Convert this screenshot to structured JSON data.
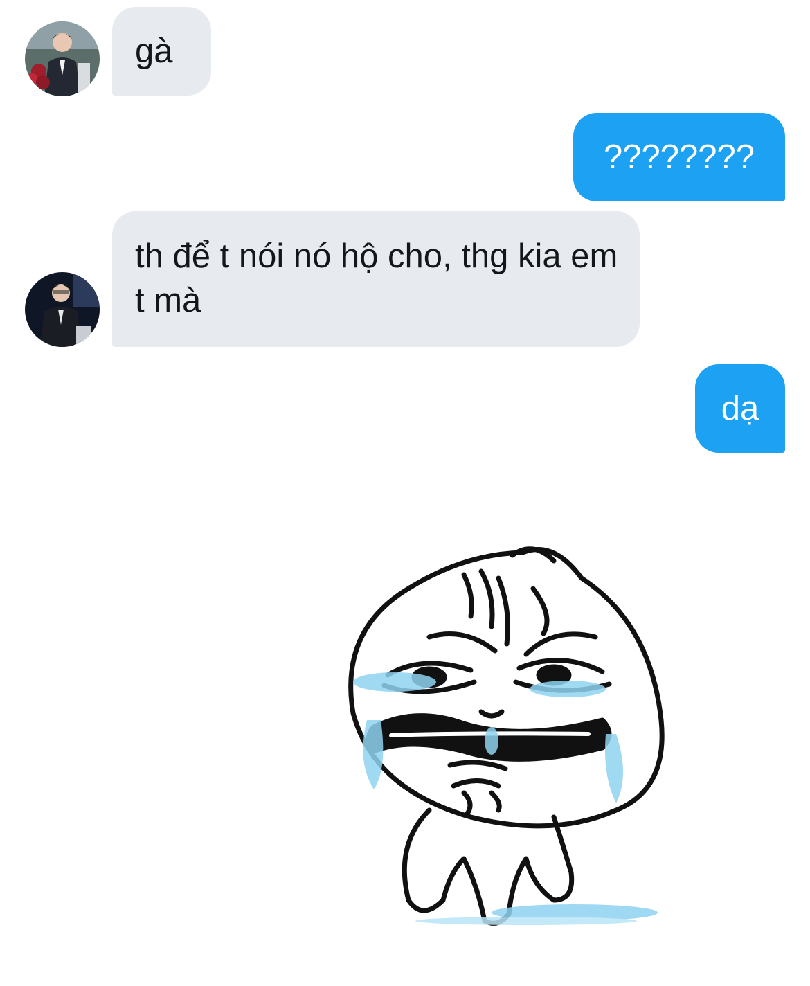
{
  "messages": [
    {
      "side": "received",
      "text": "gà",
      "avatar": "avatar-red-flowers"
    },
    {
      "side": "sent",
      "text": "????????"
    },
    {
      "side": "received",
      "text": "th để t nói nó hộ cho, thg kia em t mà",
      "avatar": "avatar-suit-dark"
    },
    {
      "side": "sent",
      "text": "dạ"
    }
  ],
  "sticker": {
    "name": "crying-meme-face-sticker"
  },
  "colors": {
    "received_bubble": "#e7ebef",
    "sent_bubble": "#1da1f2",
    "received_text": "#14171a",
    "sent_text": "#ffffff"
  }
}
